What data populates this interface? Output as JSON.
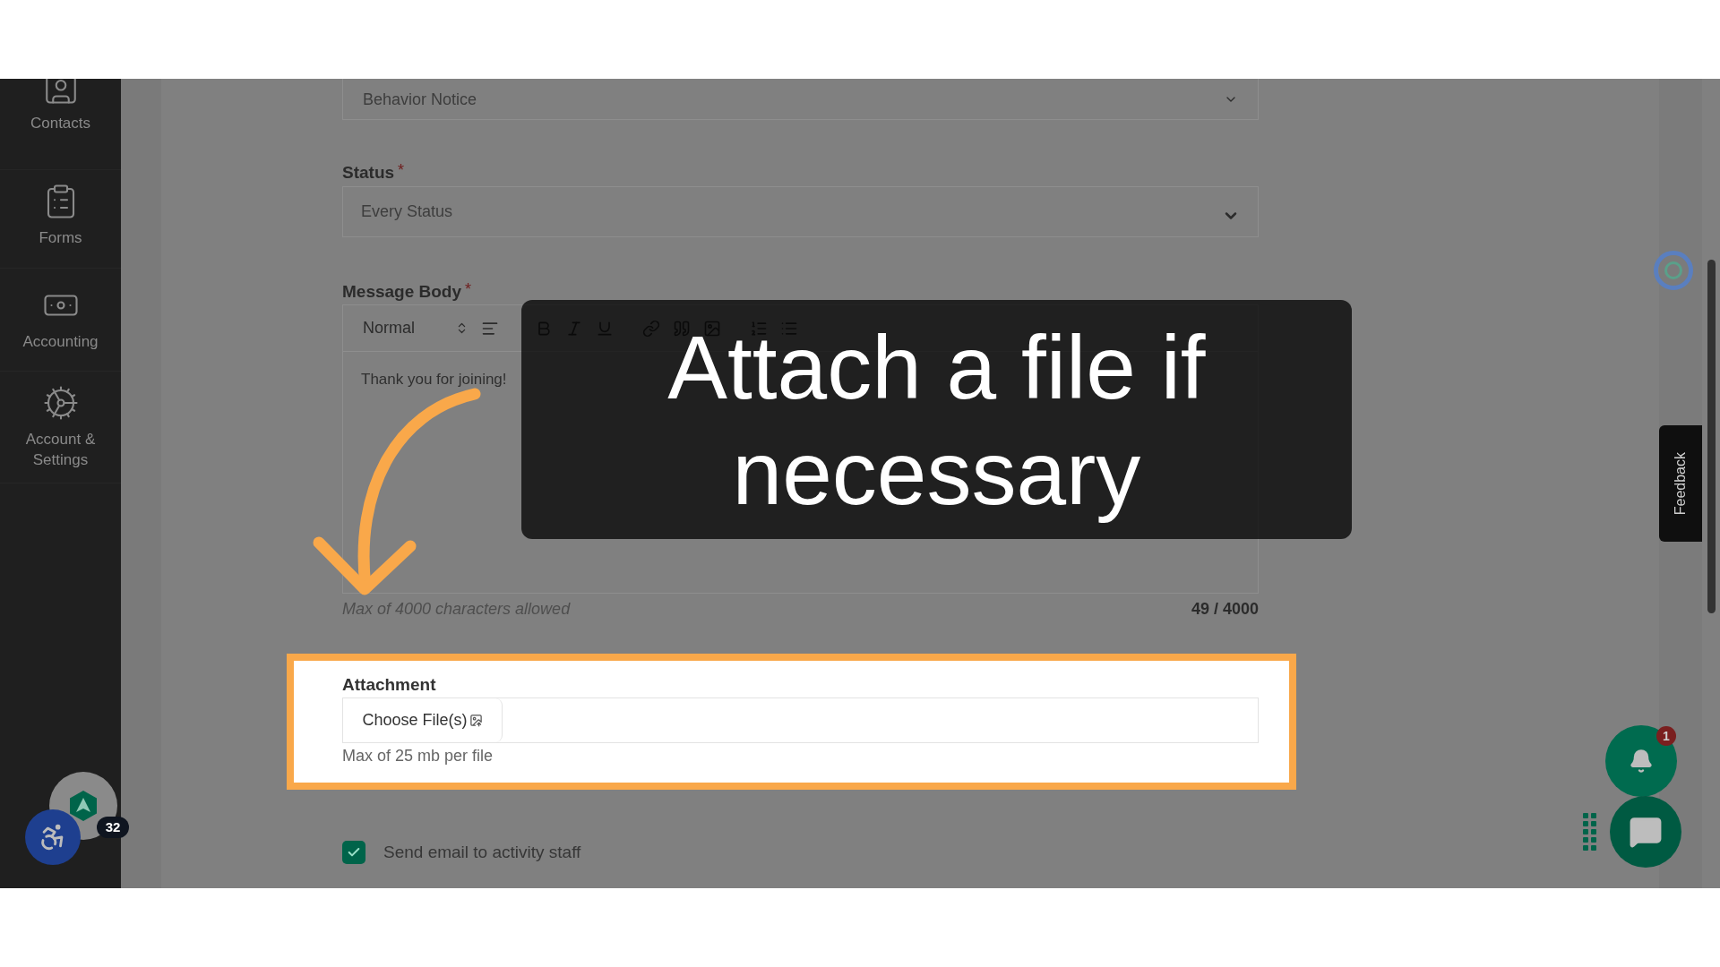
{
  "sidebar": {
    "items": [
      {
        "kind": "contacts",
        "label": "Contacts"
      },
      {
        "kind": "forms",
        "label": "Forms"
      },
      {
        "kind": "accounting",
        "label": "Accounting"
      },
      {
        "kind": "settings",
        "label": "Account & Settings"
      }
    ],
    "badge": "32"
  },
  "form": {
    "category_select": {
      "value": "Behavior Notice"
    },
    "status": {
      "label": "Status",
      "required_mark": "*",
      "value": "Every Status"
    },
    "message_body": {
      "label": "Message Body",
      "required_mark": "*",
      "format": "Normal",
      "text": "Thank you for joining!",
      "hint": "Max of 4000 characters allowed",
      "counter": "49 / 4000"
    },
    "attachment": {
      "label": "Attachment",
      "button": "Choose File(s)",
      "hint": "Max of 25 mb per file",
      "highlighted": true
    },
    "send_email": {
      "label": "Send email to activity staff",
      "checked": true
    }
  },
  "tutorial": {
    "caption": "Attach a file if necessary"
  },
  "feedback_tab": "Feedback",
  "notifications": {
    "count": "1"
  }
}
